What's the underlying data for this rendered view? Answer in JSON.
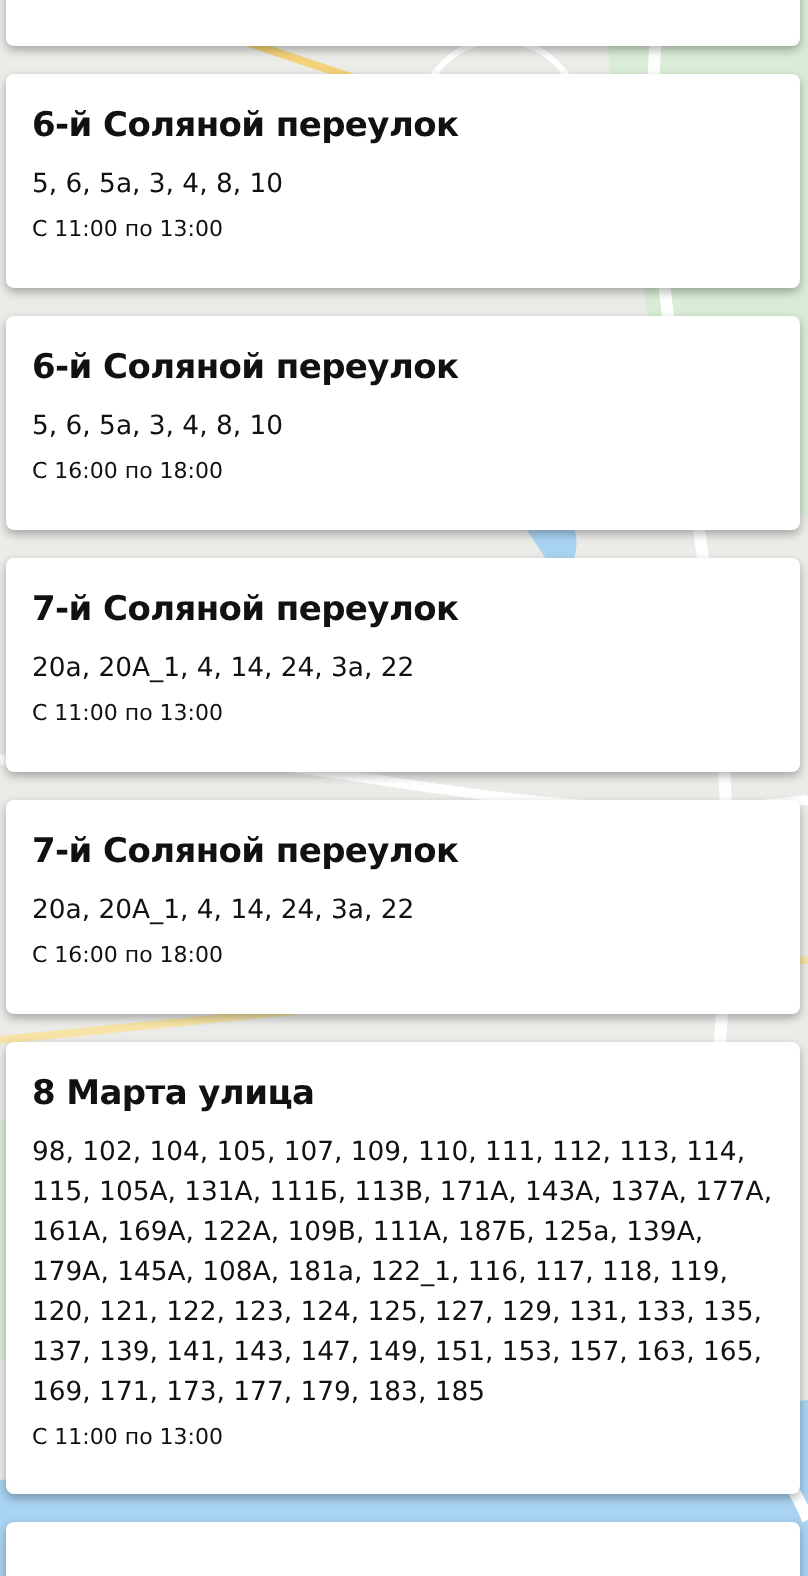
{
  "cards": [
    {
      "title": "6-й Соляной переулок",
      "addresses": "5, 6, 5а, 3, 4, 8, 10",
      "time": "С 11:00 по 13:00"
    },
    {
      "title": "6-й Соляной переулок",
      "addresses": "5, 6, 5а, 3, 4, 8, 10",
      "time": "С 16:00 по 18:00"
    },
    {
      "title": "7-й Соляной переулок",
      "addresses": "20а, 20А_1, 4, 14, 24, 3а, 22",
      "time": "С 11:00 по 13:00"
    },
    {
      "title": "7-й Соляной переулок",
      "addresses": "20а, 20А_1, 4, 14, 24, 3а, 22",
      "time": "С 16:00 по 18:00"
    },
    {
      "title": "8 Марта улица",
      "addresses": "98, 102, 104, 105, 107, 109, 110, 111, 112, 113, 114, 115, 105А, 131А, 111Б, 113В, 171А, 143А, 137А, 177А, 161А, 169А, 122А, 109В, 111А, 187Б, 125а, 139А, 179А, 145А, 108А, 181а, 122_1, 116, 117, 118, 119, 120, 121, 122, 123, 124, 125, 127, 129, 131, 133, 135, 137, 139, 141, 143, 147, 149, 151, 153, 157, 163, 165, 169, 171, 173, 177, 179, 183, 185",
      "time": "С 11:00 по 13:00"
    }
  ]
}
